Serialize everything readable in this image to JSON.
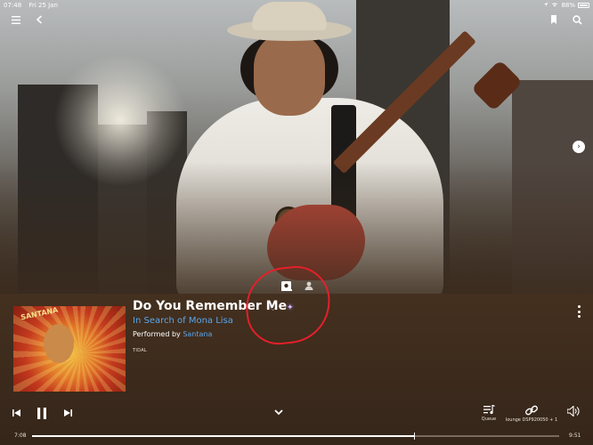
{
  "status_bar": {
    "time": "07:48",
    "date": "Fri 25 Jan",
    "battery": "88%"
  },
  "hero": {
    "icons": [
      "menu-icon",
      "back-icon",
      "bookmark-icon",
      "search-icon",
      "chevron-right-icon"
    ]
  },
  "view_toggle": {
    "icons": [
      "album-icon",
      "artist-icon"
    ],
    "active": "album-icon"
  },
  "track": {
    "title": "Do You Remember Me",
    "album": "In Search of Mona Lisa",
    "performed_prefix": "Performed by",
    "artist": "Santana",
    "source": "TIDAL",
    "favorite_icon": "heart-icon",
    "quality_icon": "sparkle-icon"
  },
  "album_art": {
    "wordmark": "SANTANA",
    "subtitle": "In Search of Mona Lisa"
  },
  "annotation": {
    "color": "#e4202a"
  },
  "controls": {
    "queue_label": "Queue",
    "output_label": "lounge DSP920050 + 1"
  },
  "progress": {
    "elapsed": "7:08",
    "total": "9:51",
    "fraction": 0.725
  },
  "colors": {
    "accent_link": "#5aa6ea",
    "panel_bg": "#3b2a1c"
  }
}
